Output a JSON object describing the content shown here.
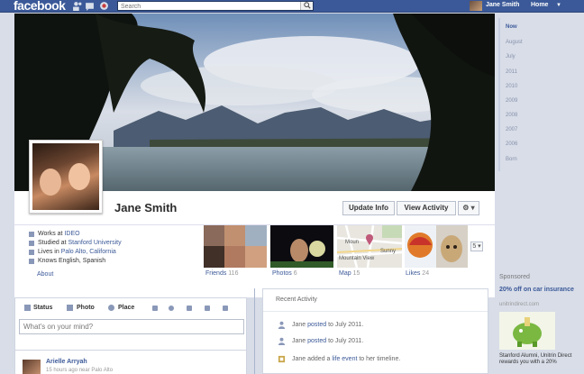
{
  "topbar": {
    "logo": "facebook",
    "search_placeholder": "Search",
    "user_name": "Jane Smith",
    "home_label": "Home"
  },
  "profile": {
    "name": "Jane Smith",
    "buttons": {
      "update_info": "Update Info",
      "view_activity": "View Activity",
      "gear": "⚙ ▾"
    },
    "about": [
      {
        "prefix": "Works at ",
        "link": "IDEO"
      },
      {
        "prefix": "Studied at ",
        "link": "Stanford University"
      },
      {
        "prefix": "Lives in ",
        "link": "Palo Alto, California"
      },
      {
        "prefix": "Knows English, Spanish",
        "link": ""
      }
    ],
    "about_link": "About",
    "tiles": [
      {
        "label": "Friends",
        "count": "116"
      },
      {
        "label": "Photos",
        "count": "6"
      },
      {
        "label": "Map",
        "count": "15"
      },
      {
        "label": "Likes",
        "count": "24"
      }
    ],
    "map_text": {
      "a": "Moun",
      "b": "Sunny",
      "c": "Mountain View"
    },
    "see_more": "5 ▾"
  },
  "composer": {
    "tabs": [
      "Status",
      "Photo",
      "Place"
    ],
    "placeholder": "What's on your mind?"
  },
  "post": {
    "author": "Arielle Arryah",
    "meta": "15 hours ago near Palo Alto"
  },
  "recent_activity": {
    "title": "Recent Activity",
    "items": [
      {
        "actor": "Jane",
        "verb": " posted ",
        "rest": "to July 2011."
      },
      {
        "actor": "Jane",
        "verb": " posted ",
        "rest": "to July 2011."
      },
      {
        "actor": "Jane",
        "verb": " added a ",
        "link": "life event",
        "rest": " to her timeline."
      }
    ]
  },
  "timeline_nav": [
    "Now",
    "August",
    "July",
    "2011",
    "2010",
    "2009",
    "2008",
    "2007",
    "2006",
    "Born"
  ],
  "sponsored": {
    "heading": "Sponsored",
    "title": "20% off on car insurance",
    "url": "unitrindirect.com",
    "body": "Stanford Alumni, Unitrin Direct rewards you with a 20%"
  },
  "colors": {
    "brand": "#3b5998",
    "background": "#d8dde8"
  }
}
